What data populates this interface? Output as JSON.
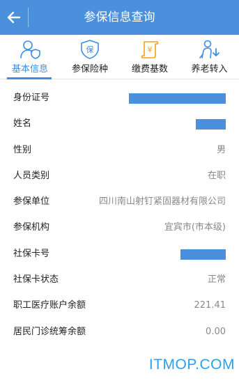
{
  "header": {
    "title": "参保信息查询",
    "background_color": "#4a90dc"
  },
  "tabs": [
    {
      "label": "基本信息",
      "icon": "person-shield-icon",
      "active": true
    },
    {
      "label": "参保险种",
      "icon": "insurance-shield-icon",
      "active": false
    },
    {
      "label": "缴费基数",
      "icon": "payment-scroll-icon",
      "active": false
    },
    {
      "label": "养老转入",
      "icon": "pension-transfer-icon",
      "active": false
    }
  ],
  "info": [
    {
      "label": "身份证号",
      "value": "",
      "redacted": true
    },
    {
      "label": "姓名",
      "value": "",
      "redacted": true
    },
    {
      "label": "性别",
      "value": "男"
    },
    {
      "label": "人员类别",
      "value": "在职"
    },
    {
      "label": "参保单位",
      "value": "四川南山射钉紧固器材有限公司"
    },
    {
      "label": "参保机构",
      "value": "宜宾市(市本级)"
    },
    {
      "label": "社保卡号",
      "value": "",
      "redacted": true
    },
    {
      "label": "社保卡状态",
      "value": "正常"
    },
    {
      "label": "职工医疗账户余额",
      "value": "221.41"
    },
    {
      "label": "居民门诊统筹余额",
      "value": "0.00"
    }
  ],
  "watermark": "ITMOP.COM",
  "colors": {
    "accent": "#3a8ee6",
    "redaction": "#4a90dc"
  }
}
